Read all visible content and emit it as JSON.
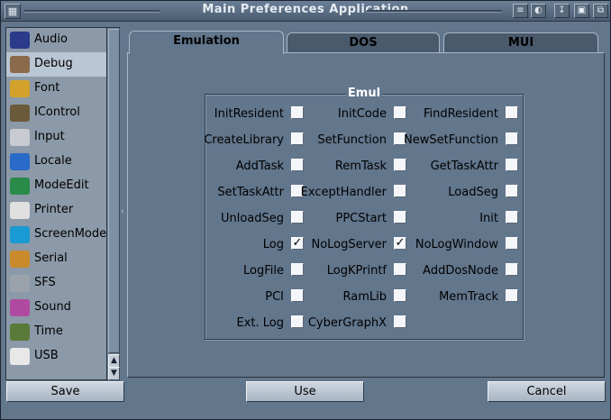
{
  "window": {
    "title": "Main Preferences Application"
  },
  "sidebar": {
    "items": [
      {
        "label": "Audio",
        "icon": "ahi-icon",
        "color": "#2b3a8a",
        "selected": false
      },
      {
        "label": "Debug",
        "icon": "bug-icon",
        "color": "#8a6a4a",
        "selected": true
      },
      {
        "label": "Font",
        "icon": "font-icon",
        "color": "#d4a22a",
        "selected": false
      },
      {
        "label": "IControl",
        "icon": "icontrol-icon",
        "color": "#6a5a3a",
        "selected": false
      },
      {
        "label": "Input",
        "icon": "mouse-icon",
        "color": "#c8ccd2",
        "selected": false
      },
      {
        "label": "Locale",
        "icon": "globe-icon",
        "color": "#2a6ac8",
        "selected": false
      },
      {
        "label": "ModeEdit",
        "icon": "monitor-icon",
        "color": "#2a8a4a",
        "selected": false
      },
      {
        "label": "Printer",
        "icon": "printer-icon",
        "color": "#e0e0e0",
        "selected": false
      },
      {
        "label": "ScreenMode",
        "icon": "screen-icon",
        "color": "#1a9ad2",
        "selected": false
      },
      {
        "label": "Serial",
        "icon": "serial-icon",
        "color": "#c88a2a",
        "selected": false
      },
      {
        "label": "SFS",
        "icon": "disk-icon",
        "color": "#9aa2ac",
        "selected": false
      },
      {
        "label": "Sound",
        "icon": "speaker-icon",
        "color": "#b04aa0",
        "selected": false
      },
      {
        "label": "Time",
        "icon": "clock-icon",
        "color": "#5a7a3a",
        "selected": false
      },
      {
        "label": "USB",
        "icon": "usb-icon",
        "color": "#e8e8e8",
        "selected": false
      }
    ]
  },
  "tabs": [
    {
      "label": "Emulation",
      "active": true
    },
    {
      "label": "DOS",
      "active": false
    },
    {
      "label": "MUI",
      "active": false
    }
  ],
  "group": {
    "title": "Emul",
    "options": [
      {
        "label": "InitResident",
        "checked": false
      },
      {
        "label": "InitCode",
        "checked": false
      },
      {
        "label": "FindResident",
        "checked": false
      },
      {
        "label": "CreateLibrary",
        "checked": false
      },
      {
        "label": "SetFunction",
        "checked": false
      },
      {
        "label": "NewSetFunction",
        "checked": false
      },
      {
        "label": "AddTask",
        "checked": false
      },
      {
        "label": "RemTask",
        "checked": false
      },
      {
        "label": "GetTaskAttr",
        "checked": false
      },
      {
        "label": "SetTaskAttr",
        "checked": false
      },
      {
        "label": "ExceptHandler",
        "checked": false
      },
      {
        "label": "LoadSeg",
        "checked": false
      },
      {
        "label": "UnloadSeg",
        "checked": false
      },
      {
        "label": "PPCStart",
        "checked": false
      },
      {
        "label": "Init",
        "checked": false
      },
      {
        "label": "Log",
        "checked": true
      },
      {
        "label": "NoLogServer",
        "checked": true
      },
      {
        "label": "NoLogWindow",
        "checked": false
      },
      {
        "label": "LogFile",
        "checked": false
      },
      {
        "label": "LogKPrintf",
        "checked": false
      },
      {
        "label": "AddDosNode",
        "checked": false
      },
      {
        "label": "PCI",
        "checked": false
      },
      {
        "label": "RamLib",
        "checked": false
      },
      {
        "label": "MemTrack",
        "checked": false
      },
      {
        "label": "Ext. Log",
        "checked": false
      },
      {
        "label": "CyberGraphX",
        "checked": false
      }
    ]
  },
  "buttons": {
    "save": "Save",
    "use": "Use",
    "cancel": "Cancel"
  }
}
